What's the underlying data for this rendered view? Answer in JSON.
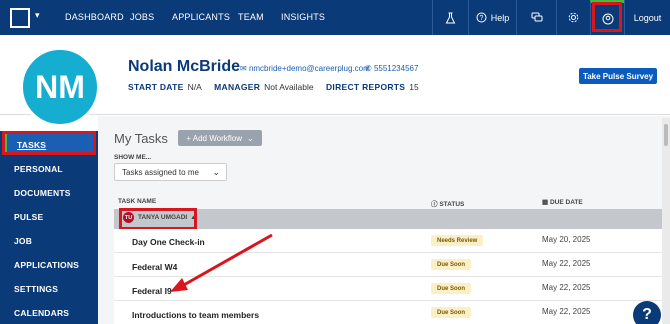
{
  "nav": {
    "links": [
      "DASHBOARD",
      "JOBS",
      "APPLICANTS",
      "TEAM",
      "INSIGHTS"
    ],
    "help_label": "Help",
    "logout_label": "Logout"
  },
  "profile": {
    "initials": "NM",
    "name": "Nolan McBride",
    "email": "nmcbride+demo@careerplug.com",
    "phone": "5551234567",
    "start_date_label": "START DATE",
    "start_date": "N/A",
    "manager_label": "MANAGER",
    "manager": "Not Available",
    "direct_reports_label": "DIRECT REPORTS",
    "direct_reports": "15",
    "pulse_button": "Take Pulse Survey"
  },
  "sidebar": {
    "items": [
      "TASKS",
      "PERSONAL",
      "DOCUMENTS",
      "PULSE",
      "JOB",
      "APPLICATIONS",
      "SETTINGS",
      "CALENDARS"
    ]
  },
  "tasks": {
    "title": "My Tasks",
    "add_workflow": "+ Add Workflow",
    "show_me_label": "SHOW ME...",
    "filter_value": "Tasks assigned to me",
    "col_task": "TASK NAME",
    "col_status": "STATUS",
    "col_due": "DUE DATE",
    "group_initials": "TU",
    "group_name": "TANYA UMGADI",
    "rows": [
      {
        "name": "Day One Check-in",
        "status": "Needs Review",
        "due": "May 20, 2025"
      },
      {
        "name": "Federal W4",
        "status": "Due Soon",
        "due": "May 22, 2025"
      },
      {
        "name": "Federal I9",
        "status": "Due Soon",
        "due": "May 22, 2025"
      },
      {
        "name": "Introductions to team members",
        "status": "Due Soon",
        "due": "May 22, 2025"
      }
    ]
  },
  "colors": {
    "nav_bg": "#0b3a78",
    "avatar_bg": "#15aed0",
    "highlight": "#d8161d",
    "badge_bg": "#fbefc8"
  }
}
